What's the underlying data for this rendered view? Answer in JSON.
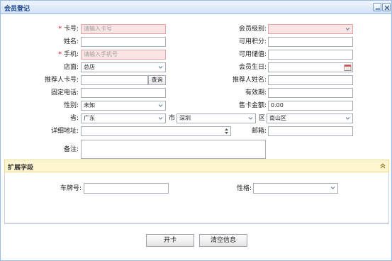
{
  "window": {
    "title": "会员登记"
  },
  "form": {
    "card_no": {
      "label": "卡号:",
      "placeholder": "请输入卡号"
    },
    "member_level": {
      "label": "会员级别:",
      "value": ""
    },
    "name": {
      "label": "姓名:",
      "value": ""
    },
    "points": {
      "label": "可用积分:",
      "value": ""
    },
    "phone": {
      "label": "手机:",
      "placeholder": "请输入手机号"
    },
    "stored_value": {
      "label": "可用储值:",
      "value": ""
    },
    "store": {
      "label": "店面:",
      "value": "总店"
    },
    "birthday": {
      "label": "会员生日:",
      "value": ""
    },
    "referrer_card": {
      "label": "推荐人卡号:",
      "value": "",
      "query_label": "查询"
    },
    "referrer_name": {
      "label": "推荐人姓名:",
      "value": ""
    },
    "landline": {
      "label": "固定电话:",
      "value": ""
    },
    "validity": {
      "label": "有效期:",
      "value": ""
    },
    "gender": {
      "label": "性别:",
      "value": "未知"
    },
    "card_amount": {
      "label": "售卡金额:",
      "value": "0.00"
    },
    "province": {
      "label": "省:",
      "value": "广东"
    },
    "city": {
      "label": "市",
      "value": "深圳"
    },
    "district": {
      "label": "区",
      "value": "南山区"
    },
    "address": {
      "label": "详细地址:",
      "value": ""
    },
    "email": {
      "label": "邮箱:",
      "value": ""
    },
    "remark": {
      "label": "备注:",
      "value": ""
    }
  },
  "extended": {
    "title": "扩展字段",
    "plate_no": {
      "label": "车牌号:",
      "value": ""
    },
    "personality": {
      "label": "性格:",
      "value": ""
    }
  },
  "actions": {
    "open_card": "开卡",
    "clear": "清空信息"
  },
  "colors": {
    "error_bg": "#fbe4e4",
    "section_bg": "#fdf5cf",
    "title_text": "#15428b"
  }
}
